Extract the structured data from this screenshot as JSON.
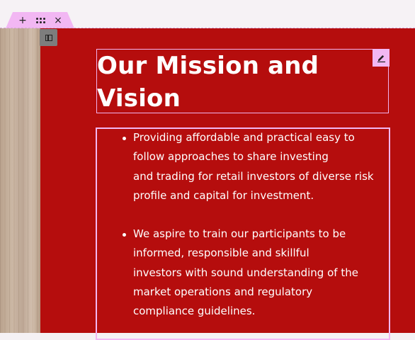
{
  "toolbar": {
    "add_icon_glyph": "+",
    "close_icon_glyph": "×",
    "accent_color": "#f2b7f3"
  },
  "section": {
    "background_color": "#b50d0d",
    "heading": "Our Mission and Vision",
    "heading_lines": [
      "Our Mission and",
      "Vision"
    ],
    "bullets": [
      {
        "text": "Providing affordable and practical easy to follow approaches to share investing and trading for retail investors of diverse risk profile and capital for investment.",
        "lines": [
          "Providing affordable and practical easy to",
          "follow approaches to share investing",
          "and trading for retail investors of diverse risk",
          "profile and capital for investment."
        ]
      },
      {
        "text": "We aspire to train our participants to be informed, responsible and skillful investors with sound understanding of the market operations and regulatory compliance guidelines.",
        "lines": [
          "We aspire to train our participants to be",
          "informed, responsible and skillful",
          "investors with sound understanding of the",
          "market operations and regulatory",
          "compliance guidelines."
        ]
      }
    ]
  }
}
